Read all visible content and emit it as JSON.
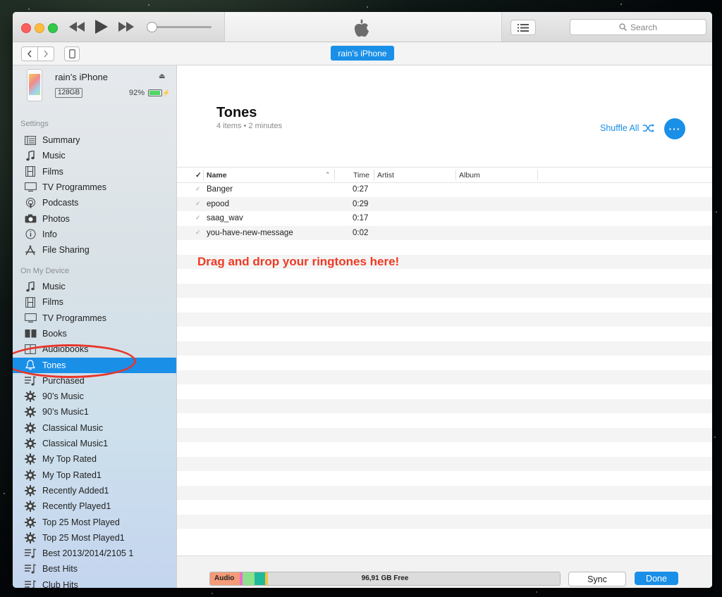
{
  "colors": {
    "accent": "#1a8fe8",
    "annotation": "#ee3a24"
  },
  "toolbar": {
    "device_button": "rain’s iPhone"
  },
  "search": {
    "placeholder": "Search"
  },
  "device": {
    "name": "rain’s iPhone",
    "capacity": "128GB",
    "battery": "92%"
  },
  "sidebar": {
    "settings_header": "Settings",
    "settings": [
      {
        "label": "Summary",
        "icon": "summary-icon"
      },
      {
        "label": "Music",
        "icon": "music-note-icon"
      },
      {
        "label": "Films",
        "icon": "film-icon"
      },
      {
        "label": "TV Programmes",
        "icon": "tv-icon"
      },
      {
        "label": "Podcasts",
        "icon": "podcast-icon"
      },
      {
        "label": "Photos",
        "icon": "camera-icon"
      },
      {
        "label": "Info",
        "icon": "info-icon"
      },
      {
        "label": "File Sharing",
        "icon": "app-store-icon"
      }
    ],
    "device_header": "On My Device",
    "on_device": [
      {
        "label": "Music",
        "icon": "music-note-icon"
      },
      {
        "label": "Films",
        "icon": "film-icon"
      },
      {
        "label": "TV Programmes",
        "icon": "tv-icon"
      },
      {
        "label": "Books",
        "icon": "book-icon"
      },
      {
        "label": "Audiobooks",
        "icon": "audiobook-icon"
      },
      {
        "label": "Tones",
        "icon": "bell-icon",
        "selected": true
      },
      {
        "label": "Purchased",
        "icon": "playlist-icon"
      },
      {
        "label": "90’s Music",
        "icon": "smart-playlist-gear-icon"
      },
      {
        "label": "90’s Music1",
        "icon": "smart-playlist-gear-icon"
      },
      {
        "label": "Classical Music",
        "icon": "smart-playlist-gear-icon"
      },
      {
        "label": "Classical Music1",
        "icon": "smart-playlist-gear-icon"
      },
      {
        "label": "My Top Rated",
        "icon": "smart-playlist-gear-icon"
      },
      {
        "label": "My Top Rated1",
        "icon": "smart-playlist-gear-icon"
      },
      {
        "label": "Recently Added1",
        "icon": "smart-playlist-gear-icon"
      },
      {
        "label": "Recently Played1",
        "icon": "smart-playlist-gear-icon"
      },
      {
        "label": "Top 25 Most Played",
        "icon": "smart-playlist-gear-icon"
      },
      {
        "label": "Top 25 Most Played1",
        "icon": "smart-playlist-gear-icon"
      },
      {
        "label": "Best 2013/2014/2105 1",
        "icon": "playlist-icon"
      },
      {
        "label": "Best Hits",
        "icon": "playlist-icon"
      },
      {
        "label": "Club Hits",
        "icon": "playlist-icon"
      },
      {
        "label": "",
        "icon": "playlist-icon"
      }
    ]
  },
  "main": {
    "title": "Tones",
    "subtitle": "4 items • 2 minutes",
    "shuffle_label": "Shuffle All",
    "more_label": "···",
    "columns": {
      "check": "✓",
      "name": "Name",
      "time": "Time",
      "artist": "Artist",
      "album": "Album"
    },
    "tracks": [
      {
        "name": "Banger",
        "time": "0:27"
      },
      {
        "name": "epood",
        "time": "0:29"
      },
      {
        "name": "saag_wav",
        "time": "0:17"
      },
      {
        "name": "you-have-new-message",
        "time": "0:02"
      }
    ],
    "drop_note": "Drag and drop your ringtones here!"
  },
  "storage": {
    "audio_label": "Audio",
    "free_label": "96,91 GB Free",
    "segments": [
      {
        "name": "Audio",
        "fraction": 0.085,
        "color": "#f49b78"
      },
      {
        "name": "Pink",
        "fraction": 0.008,
        "color": "#ee6bd1"
      },
      {
        "name": "Light green",
        "fraction": 0.035,
        "color": "#8fe08e"
      },
      {
        "name": "Teal",
        "fraction": 0.03,
        "color": "#21b99b"
      },
      {
        "name": "Yellow",
        "fraction": 0.008,
        "color": "#f5c33b"
      }
    ]
  },
  "buttons": {
    "sync": "Sync",
    "done": "Done"
  }
}
